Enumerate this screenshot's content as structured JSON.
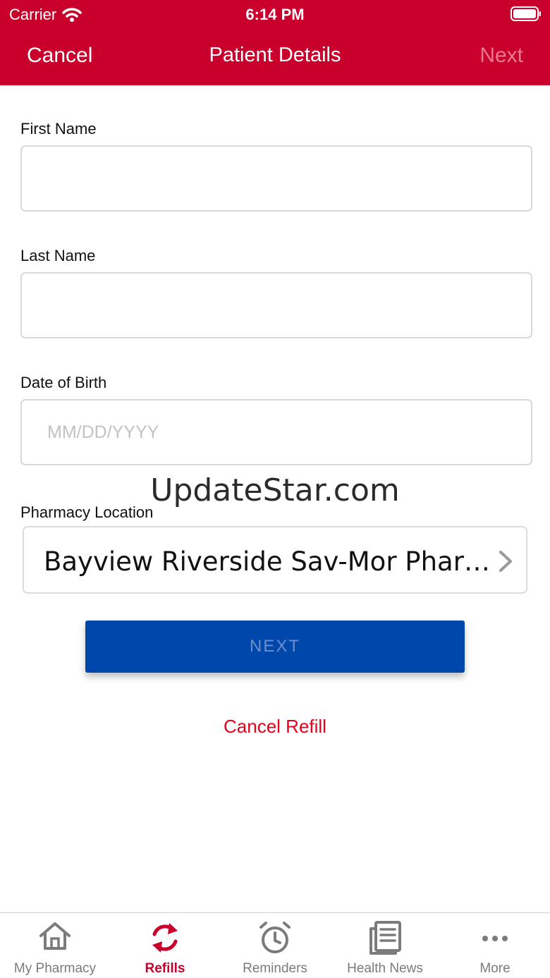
{
  "status_bar": {
    "carrier": "Carrier",
    "time": "6:14 PM"
  },
  "nav": {
    "cancel_label": "Cancel",
    "title": "Patient Details",
    "next_label": "Next"
  },
  "form": {
    "first_name": {
      "label": "First Name",
      "value": "",
      "placeholder": ""
    },
    "last_name": {
      "label": "Last Name",
      "value": "",
      "placeholder": ""
    },
    "dob": {
      "label": "Date of Birth",
      "value": "",
      "placeholder": "MM/DD/YYYY"
    },
    "pharmacy": {
      "label": "Pharmacy Location",
      "value": "Bayview Riverside Sav-Mor Phar…"
    }
  },
  "watermark": "UpdateStar.com",
  "next_button_label": "NEXT",
  "cancel_refill_label": "Cancel Refill",
  "tabs": [
    {
      "label": "My Pharmacy",
      "icon": "home-icon",
      "active": false
    },
    {
      "label": "Refills",
      "icon": "refresh-icon",
      "active": true
    },
    {
      "label": "Reminders",
      "icon": "alarm-clock-icon",
      "active": false
    },
    {
      "label": "Health News",
      "icon": "newspaper-icon",
      "active": false
    },
    {
      "label": "More",
      "icon": "more-icon",
      "active": false
    }
  ],
  "colors": {
    "brand_red": "#c8002b",
    "button_blue": "#0047ab",
    "cancel_red": "#e8001a",
    "tab_inactive": "#7b7b7b"
  }
}
